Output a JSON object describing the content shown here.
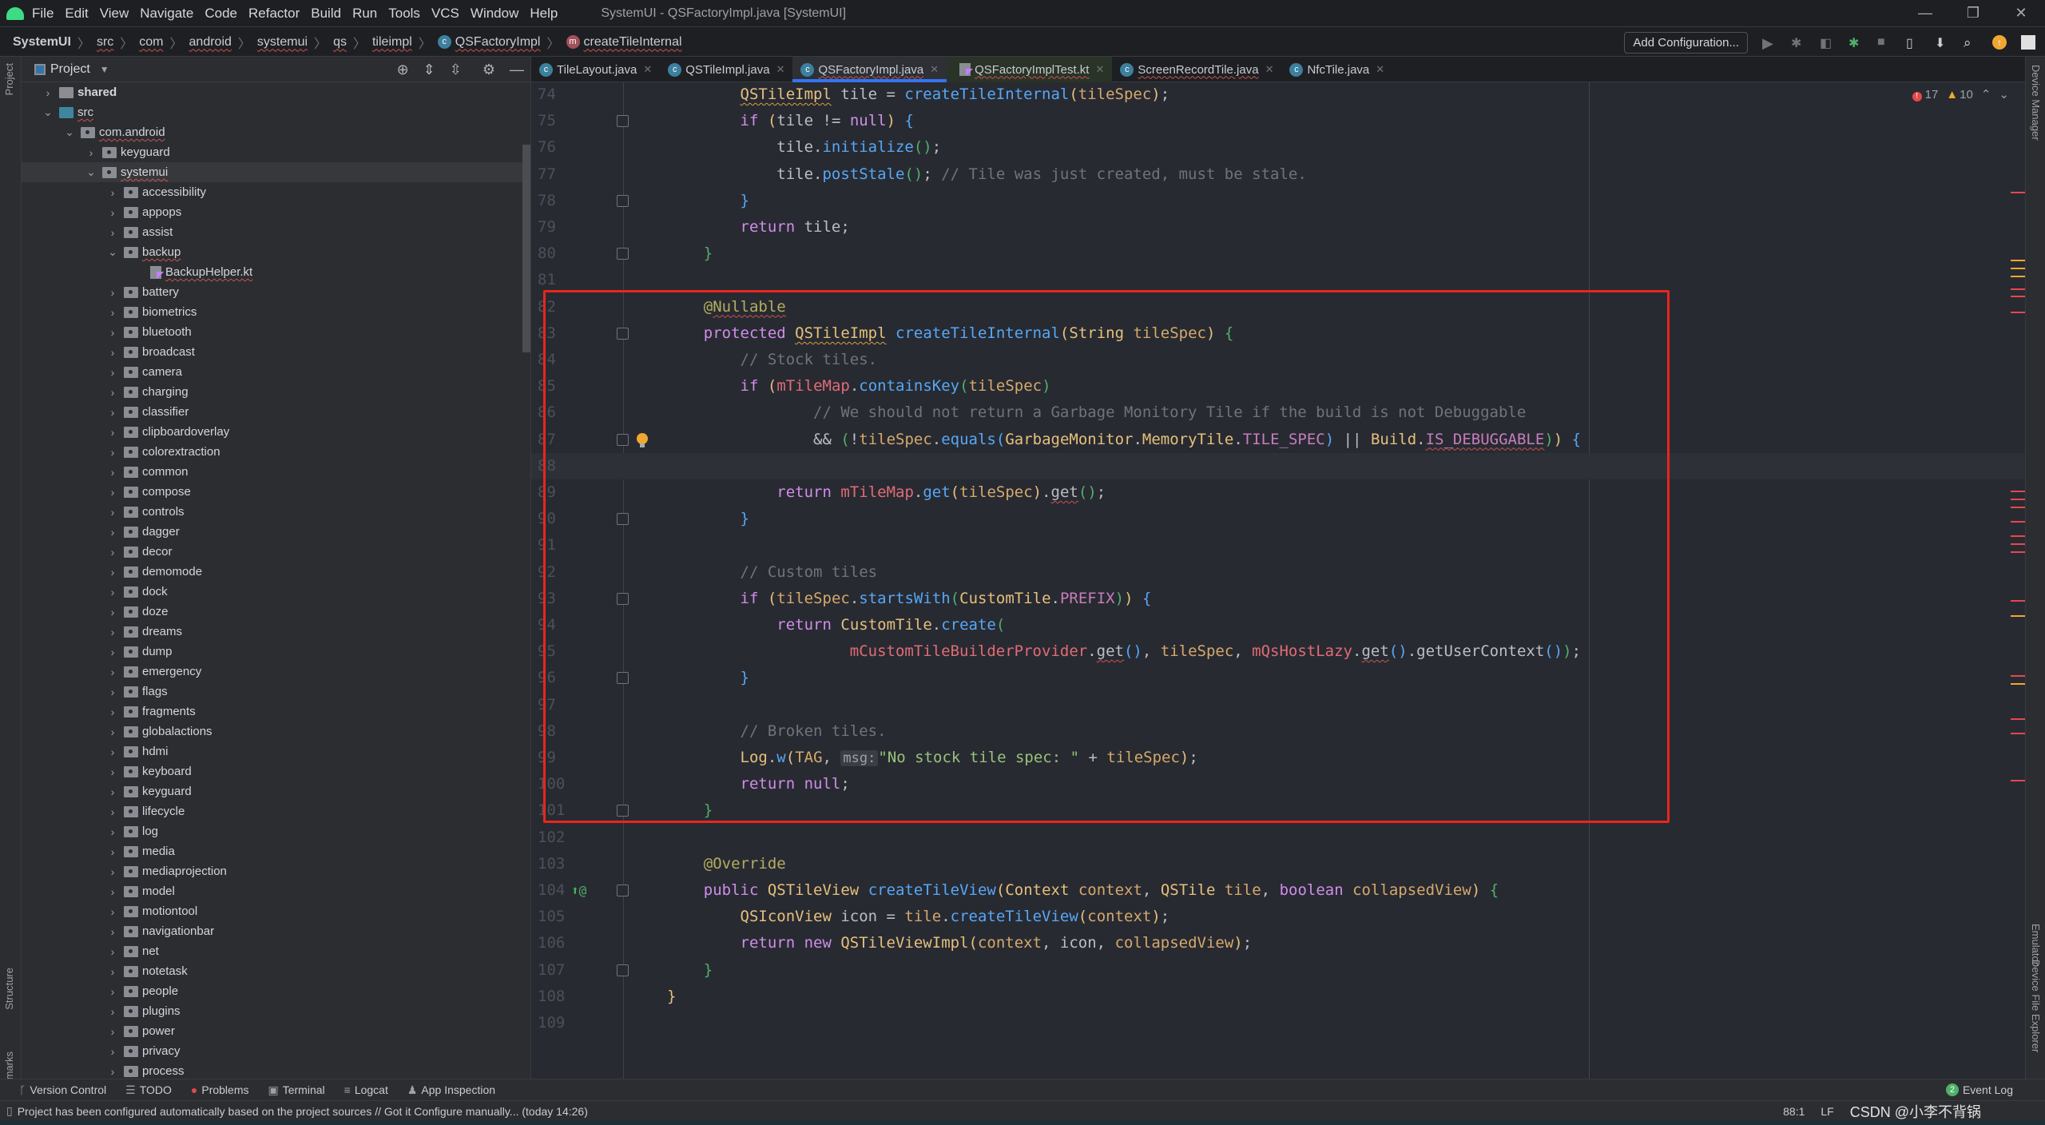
{
  "app": {
    "menu": [
      "File",
      "Edit",
      "View",
      "Navigate",
      "Code",
      "Refactor",
      "Build",
      "Run",
      "Tools",
      "VCS",
      "Window",
      "Help"
    ],
    "window_title": "SystemUI - QSFactoryImpl.java [SystemUI]",
    "window_controls": [
      "minimize",
      "restore",
      "close"
    ]
  },
  "breadcrumb": [
    {
      "label": "SystemUI",
      "icon": ""
    },
    {
      "label": "src",
      "icon": ""
    },
    {
      "label": "com",
      "icon": ""
    },
    {
      "label": "android",
      "icon": ""
    },
    {
      "label": "systemui",
      "icon": ""
    },
    {
      "label": "qs",
      "icon": ""
    },
    {
      "label": "tileimpl",
      "icon": ""
    },
    {
      "label": "QSFactoryImpl",
      "icon": "c"
    },
    {
      "label": "createTileInternal",
      "icon": "m"
    }
  ],
  "toolbar": {
    "add_configuration": "Add Configuration...",
    "icons": [
      "run-icon",
      "debug-icon",
      "profile-icon",
      "attach-debugger-icon",
      "stop-icon",
      "device-manager-icon",
      "sdk-manager-icon",
      "search-icon",
      "update-icon",
      "avatar-icon"
    ]
  },
  "project_panel": {
    "title": "Project",
    "tools": [
      "locate-icon",
      "expand-all-icon",
      "collapse-all-icon",
      "gear-icon",
      "hide-icon"
    ],
    "tree": [
      {
        "label": "shared",
        "depth": 1,
        "expanded": false,
        "type": "shared",
        "bold": true
      },
      {
        "label": "src",
        "depth": 1,
        "expanded": true,
        "type": "src",
        "wavy": true
      },
      {
        "label": "com.android",
        "depth": 2,
        "expanded": true,
        "type": "pkg",
        "wavy": true
      },
      {
        "label": "keyguard",
        "depth": 3,
        "expanded": false,
        "type": "pkg"
      },
      {
        "label": "systemui",
        "depth": 3,
        "expanded": true,
        "type": "pkg",
        "wavy": true,
        "selected": true
      },
      {
        "label": "accessibility",
        "depth": 4,
        "expanded": false,
        "type": "pkg"
      },
      {
        "label": "appops",
        "depth": 4,
        "expanded": false,
        "type": "pkg"
      },
      {
        "label": "assist",
        "depth": 4,
        "expanded": false,
        "type": "pkg"
      },
      {
        "label": "backup",
        "depth": 4,
        "expanded": true,
        "type": "pkg",
        "wavy": true
      },
      {
        "label": "BackupHelper.kt",
        "depth": 5,
        "type": "kt",
        "wavy": true
      },
      {
        "label": "battery",
        "depth": 4,
        "expanded": false,
        "type": "pkg"
      },
      {
        "label": "biometrics",
        "depth": 4,
        "expanded": false,
        "type": "pkg"
      },
      {
        "label": "bluetooth",
        "depth": 4,
        "expanded": false,
        "type": "pkg"
      },
      {
        "label": "broadcast",
        "depth": 4,
        "expanded": false,
        "type": "pkg"
      },
      {
        "label": "camera",
        "depth": 4,
        "expanded": false,
        "type": "pkg"
      },
      {
        "label": "charging",
        "depth": 4,
        "expanded": false,
        "type": "pkg"
      },
      {
        "label": "classifier",
        "depth": 4,
        "expanded": false,
        "type": "pkg"
      },
      {
        "label": "clipboardoverlay",
        "depth": 4,
        "expanded": false,
        "type": "pkg"
      },
      {
        "label": "colorextraction",
        "depth": 4,
        "expanded": false,
        "type": "pkg"
      },
      {
        "label": "common",
        "depth": 4,
        "expanded": false,
        "type": "pkg"
      },
      {
        "label": "compose",
        "depth": 4,
        "expanded": false,
        "type": "pkg"
      },
      {
        "label": "controls",
        "depth": 4,
        "expanded": false,
        "type": "pkg"
      },
      {
        "label": "dagger",
        "depth": 4,
        "expanded": false,
        "type": "pkg"
      },
      {
        "label": "decor",
        "depth": 4,
        "expanded": false,
        "type": "pkg"
      },
      {
        "label": "demomode",
        "depth": 4,
        "expanded": false,
        "type": "pkg"
      },
      {
        "label": "dock",
        "depth": 4,
        "expanded": false,
        "type": "pkg"
      },
      {
        "label": "doze",
        "depth": 4,
        "expanded": false,
        "type": "pkg"
      },
      {
        "label": "dreams",
        "depth": 4,
        "expanded": false,
        "type": "pkg"
      },
      {
        "label": "dump",
        "depth": 4,
        "expanded": false,
        "type": "pkg"
      },
      {
        "label": "emergency",
        "depth": 4,
        "expanded": false,
        "type": "pkg"
      },
      {
        "label": "flags",
        "depth": 4,
        "expanded": false,
        "type": "pkg"
      },
      {
        "label": "fragments",
        "depth": 4,
        "expanded": false,
        "type": "pkg"
      },
      {
        "label": "globalactions",
        "depth": 4,
        "expanded": false,
        "type": "pkg"
      },
      {
        "label": "hdmi",
        "depth": 4,
        "expanded": false,
        "type": "pkg"
      },
      {
        "label": "keyboard",
        "depth": 4,
        "expanded": false,
        "type": "pkg"
      },
      {
        "label": "keyguard",
        "depth": 4,
        "expanded": false,
        "type": "pkg"
      },
      {
        "label": "lifecycle",
        "depth": 4,
        "expanded": false,
        "type": "pkg"
      },
      {
        "label": "log",
        "depth": 4,
        "expanded": false,
        "type": "pkg"
      },
      {
        "label": "media",
        "depth": 4,
        "expanded": false,
        "type": "pkg"
      },
      {
        "label": "mediaprojection",
        "depth": 4,
        "expanded": false,
        "type": "pkg"
      },
      {
        "label": "model",
        "depth": 4,
        "expanded": false,
        "type": "pkg"
      },
      {
        "label": "motiontool",
        "depth": 4,
        "expanded": false,
        "type": "pkg"
      },
      {
        "label": "navigationbar",
        "depth": 4,
        "expanded": false,
        "type": "pkg"
      },
      {
        "label": "net",
        "depth": 4,
        "expanded": false,
        "type": "pkg"
      },
      {
        "label": "notetask",
        "depth": 4,
        "expanded": false,
        "type": "pkg"
      },
      {
        "label": "people",
        "depth": 4,
        "expanded": false,
        "type": "pkg"
      },
      {
        "label": "plugins",
        "depth": 4,
        "expanded": false,
        "type": "pkg"
      },
      {
        "label": "power",
        "depth": 4,
        "expanded": false,
        "type": "pkg"
      },
      {
        "label": "privacy",
        "depth": 4,
        "expanded": false,
        "type": "pkg"
      },
      {
        "label": "process",
        "depth": 4,
        "expanded": false,
        "type": "pkg"
      }
    ]
  },
  "side_strips": {
    "left_top": "Project",
    "left_bottom": [
      "Structure",
      "Bookmarks"
    ],
    "right": [
      "Device Manager",
      "Emulator",
      "Device File Explorer"
    ]
  },
  "tabs": [
    {
      "label": "TileLayout.java",
      "icon": "c",
      "active": false
    },
    {
      "label": "QSTileImpl.java",
      "icon": "c",
      "active": false
    },
    {
      "label": "QSFactoryImpl.java",
      "icon": "c",
      "active": true,
      "wavy": true
    },
    {
      "label": "QSFactoryImplTest.kt",
      "icon": "kt",
      "active": false,
      "wavy": true
    },
    {
      "label": "ScreenRecordTile.java",
      "icon": "c",
      "active": false,
      "wavy": true
    },
    {
      "label": "NfcTile.java",
      "icon": "c",
      "active": false
    }
  ],
  "inspections": {
    "errors": "17",
    "warnings": "10"
  },
  "editor": {
    "current_line": 88,
    "lines": [
      {
        "n": "74",
        "html": "        <span class='ty wvo'>QSTileImpl</span> tile = <span class='fn'>createTileInternal</span><span class='b1'>(</span><span class='pa'>tileSpec</span><span class='b1'>)</span>;"
      },
      {
        "n": "75",
        "fold": true,
        "html": "        <span class='kw'>if</span> <span class='b1'>(</span>tile != <span class='kw'>null</span><span class='b1'>)</span> <span class='b3'>{</span>"
      },
      {
        "n": "76",
        "html": "            tile.<span class='fn'>initialize</span><span class='b2'>()</span>;"
      },
      {
        "n": "77",
        "html": "            tile.<span class='fn'>postStale</span><span class='b2'>()</span>; <span class='cm'>// Tile was just created, must be stale.</span>"
      },
      {
        "n": "78",
        "fold": true,
        "html": "        <span class='b3'>}</span>"
      },
      {
        "n": "79",
        "html": "        <span class='kw'>return</span> tile;"
      },
      {
        "n": "80",
        "fold": true,
        "html": "    <span class='b2'>}</span>"
      },
      {
        "n": "81",
        "html": ""
      },
      {
        "n": "82",
        "html": "    <span class='an'>@<span class='wvy'>Nullable</span></span>"
      },
      {
        "n": "83",
        "fold": true,
        "html": "    <span class='kw'>protected</span> <span class='ty wvo'>QSTileImpl</span> <span class='fn'>createTileInternal</span><span class='b1'>(</span><span class='ty'>String</span> <span class='pa'>tileSpec</span><span class='b1'>)</span> <span class='b2'>{</span>"
      },
      {
        "n": "84",
        "html": "        <span class='cm'>// Stock tiles.</span>"
      },
      {
        "n": "85",
        "html": "        <span class='kw'>if</span> <span class='b1'>(</span><span class='fd'>mTileMap</span>.<span class='fn'>containsKey</span><span class='b2'>(</span><span class='pa'>tileSpec</span><span class='b2'>)</span>"
      },
      {
        "n": "86",
        "html": "                <span class='cm'>// We should not return a Garbage Monitory Tile if the build is not Debuggable</span>"
      },
      {
        "n": "87",
        "fold": true,
        "bulb": true,
        "html": "                &amp;&amp; <span class='b2'>(</span>!<span class='pa'>tileSpec</span>.<span class='fn'>equals</span><span class='b3'>(</span><span class='ty'>GarbageMonitor</span>.<span class='ty'>MemoryTile</span>.<span class='cn'>TILE_SPEC</span><span class='b3'>)</span> || <span class='ty'>Build</span>.<span class='cn wvy'>IS_DEBUGGABLE</span><span class='b2'>)</span><span class='b1'>)</span> <span class='b3'>{</span>"
      },
      {
        "n": "88",
        "html": ""
      },
      {
        "n": "89",
        "html": "            <span class='kw'>return</span> <span class='fd'>mTileMap</span>.<span class='fn'>get</span><span class='b1'>(</span><span class='pa'>tileSpec</span><span class='b1'>)</span>.<span class='wvy'>get</span><span class='b2'>()</span>;"
      },
      {
        "n": "90",
        "fold": true,
        "html": "        <span class='b3'>}</span>"
      },
      {
        "n": "91",
        "html": ""
      },
      {
        "n": "92",
        "html": "        <span class='cm'>// Custom tiles</span>"
      },
      {
        "n": "93",
        "fold": true,
        "html": "        <span class='kw'>if</span> <span class='b1'>(</span><span class='pa'>tileSpec</span>.<span class='fn'>startsWith</span><span class='b2'>(</span><span class='ty'>CustomTile</span>.<span class='cn'>PREFIX</span><span class='b2'>)</span><span class='b1'>)</span> <span class='b3'>{</span>"
      },
      {
        "n": "94",
        "html": "            <span class='kw'>return</span> <span class='ty'>CustomTile</span>.<span class='fn'>create</span><span class='b2'>(</span>"
      },
      {
        "n": "95",
        "html": "                    <span class='fd'>mCustomTileBuilderProvider</span>.<span class='wvy'>get</span><span class='b3'>()</span>, <span class='pa'>tileSpec</span>, <span class='fd'>mQsHostLazy</span>.<span class='wvy'>get</span><span class='b3'>()</span>.getUserContext<span class='b3'>()</span><span class='b2'>)</span>;"
      },
      {
        "n": "96",
        "fold": true,
        "html": "        <span class='b3'>}</span>"
      },
      {
        "n": "97",
        "html": ""
      },
      {
        "n": "98",
        "html": "        <span class='cm'>// Broken tiles.</span>"
      },
      {
        "n": "99",
        "html": "        <span class='ty'>Log</span>.<span class='fn'>w</span><span class='b1'>(</span><span class='cn' style='color:#d5a96a'>TAG</span>, <span class='hint'>msg:</span><span class='st'>\"No stock tile spec: \"</span> + <span class='pa'>tileSpec</span><span class='b1'>)</span>;"
      },
      {
        "n": "100",
        "html": "        <span class='kw'>return null</span>;"
      },
      {
        "n": "101",
        "fold": true,
        "html": "    <span class='b2'>}</span>"
      },
      {
        "n": "102",
        "html": ""
      },
      {
        "n": "103",
        "html": "    <span class='an'>@Override</span>"
      },
      {
        "n": "104",
        "fold": true,
        "override": true,
        "html": "    <span class='kw'>public</span> <span class='ty'>QSTileView</span> <span class='fn'>createTileView</span><span class='b1'>(</span><span class='ty'>Context</span> <span class='pa'>context</span>, <span class='ty'>QSTile</span> <span class='pa'>tile</span>, <span class='kw'>boolean</span> <span class='pa'>collapsedView</span><span class='b1'>)</span> <span class='b2'>{</span>"
      },
      {
        "n": "105",
        "html": "        <span class='ty'>QSIconView</span> icon = <span class='pa'>tile</span>.<span class='fn'>createTileView</span><span class='b1'>(</span><span class='pa'>context</span><span class='b1'>)</span>;"
      },
      {
        "n": "106",
        "html": "        <span class='kw'>return new</span> <span class='ty'>QSTileViewImpl</span><span class='b1'>(</span><span class='pa'>context</span>, icon, <span class='pa'>collapsedView</span><span class='b1'>)</span>;"
      },
      {
        "n": "107",
        "fold": true,
        "html": "    <span class='b2'>}</span>"
      },
      {
        "n": "108",
        "html": "<span class='b1'>}</span>"
      },
      {
        "n": "109",
        "html": ""
      }
    ]
  },
  "tool_windows": [
    {
      "label": "Version Control",
      "icon": "ᚴ"
    },
    {
      "label": "TODO",
      "icon": "☰"
    },
    {
      "label": "Problems",
      "icon": "●"
    },
    {
      "label": "Terminal",
      "icon": "▣"
    },
    {
      "label": "Logcat",
      "icon": "≡"
    },
    {
      "label": "App Inspection",
      "icon": "♟"
    }
  ],
  "event_log": {
    "count": "2",
    "label": "Event Log"
  },
  "status": {
    "message": "Project has been configured automatically based on the project sources // Got it   Configure manually... (today 14:26)",
    "position": "88:1",
    "line_sep": "LF",
    "watermark": "CSDN @小李不背锅"
  },
  "colors": {
    "accent": "#3574f0",
    "error": "#e5484d",
    "warning": "#f0a732",
    "annotation_box": "#e8261c"
  }
}
